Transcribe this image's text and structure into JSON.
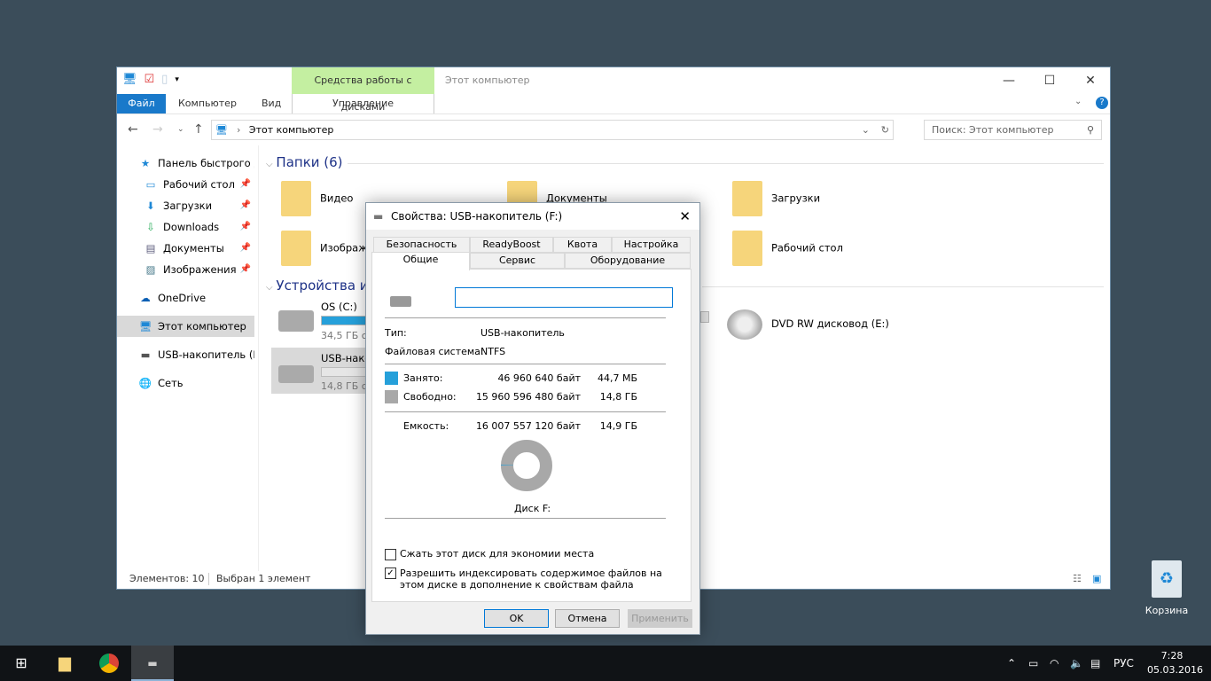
{
  "window": {
    "title": "Этот компьютер",
    "context_tab": "Средства работы с дисками",
    "context_subtab": "Управление",
    "ribbon_tabs": [
      "Файл",
      "Компьютер",
      "Вид"
    ],
    "address": "Этот компьютер",
    "search_placeholder": "Поиск: Этот компьютер",
    "controls": {
      "minimize": "—",
      "maximize": "☐",
      "close": "✕"
    }
  },
  "sidebar": {
    "items": [
      {
        "label": "Панель быстрого доступа",
        "icon": "star-icon"
      },
      {
        "label": "Рабочий стол",
        "icon": "desktop-icon",
        "pinned": true
      },
      {
        "label": "Загрузки",
        "icon": "download-icon",
        "pinned": true
      },
      {
        "label": "Downloads",
        "icon": "download-icon",
        "pinned": true
      },
      {
        "label": "Документы",
        "icon": "document-icon",
        "pinned": true
      },
      {
        "label": "Изображения",
        "icon": "image-icon",
        "pinned": true
      },
      {
        "label": "OneDrive",
        "icon": "cloud-icon"
      },
      {
        "label": "Этот компьютер",
        "icon": "computer-icon",
        "selected": true
      },
      {
        "label": "USB-накопитель (F:)",
        "icon": "usb-drive-icon"
      },
      {
        "label": "Сеть",
        "icon": "network-icon"
      }
    ]
  },
  "main": {
    "folders_header": "Папки (6)",
    "folders": [
      "Видео",
      "Документы",
      "Загрузки",
      "Изображения",
      "Рабочий стол"
    ],
    "devices_header": "Устройства и диски",
    "devices": [
      {
        "name": "OS (C:)",
        "free": "34,5 ГБ св",
        "used_fraction": 0.7
      },
      {
        "name": "USB-накопитель (F:)",
        "free": "14,8 ГБ св",
        "used_fraction": 0.003,
        "selected": true
      },
      {
        "name": "DVD RW дисковод (E:)"
      }
    ]
  },
  "status": {
    "count": "Элементов: 10",
    "selected": "Выбран 1 элемент"
  },
  "dialog": {
    "title": "Свойства: USB-накопитель (F:)",
    "tabs_back": [
      "Безопасность",
      "ReadyBoost",
      "Квота",
      "Настройка"
    ],
    "tabs_front": [
      "Общие",
      "Сервис",
      "Оборудование"
    ],
    "active_tab": "Общие",
    "label_value": "",
    "type_label": "Тип:",
    "type_value": "USB-накопитель",
    "fs_label": "Файловая система:",
    "fs_value": "NTFS",
    "used_label": "Занято:",
    "used_bytes": "46 960 640 байт",
    "used_size": "44,7 МБ",
    "free_label": "Свободно:",
    "free_bytes": "15 960 596 480 байт",
    "free_size": "14,8 ГБ",
    "cap_label": "Емкость:",
    "cap_bytes": "16 007 557 120 байт",
    "cap_size": "14,9 ГБ",
    "disk_label": "Диск F:",
    "used_fraction": 0.0029,
    "compress_label": "Сжать этот диск для экономии места",
    "compress_checked": false,
    "index_label": "Разрешить индексировать содержимое файлов на этом диске в дополнение к свойствам файла",
    "index_checked": true,
    "ok": "OK",
    "cancel": "Отмена",
    "apply": "Применить",
    "colors": {
      "used": "#26a0da",
      "free": "#a8a8a8"
    }
  },
  "desktop": {
    "recycle_bin": "Корзина"
  },
  "taskbar": {
    "lang": "РУС",
    "time": "7:28",
    "date": "05.03.2016"
  }
}
